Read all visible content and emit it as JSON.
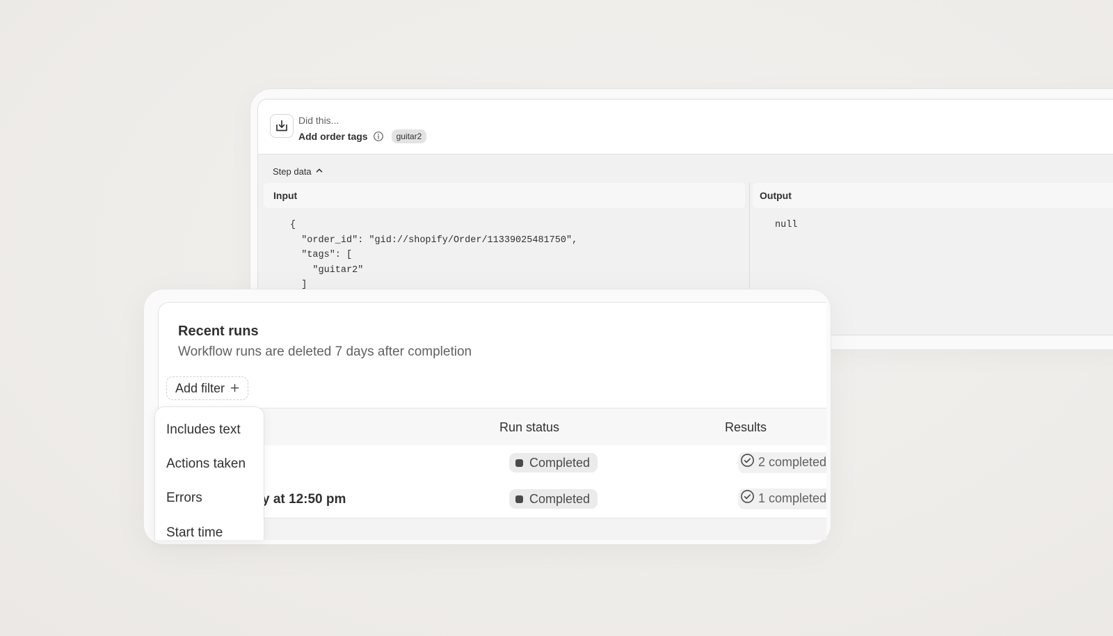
{
  "step": {
    "heading": "Did this...",
    "action_name": "Add order tags",
    "tag": "guitar2",
    "step_data_label": "Step data",
    "input_label": "Input",
    "output_label": "Output",
    "input_code": "{\n  \"order_id\": \"gid://shopify/Order/11339025481750\",\n  \"tags\": [\n    \"guitar2\"\n  ]",
    "output_code": "null"
  },
  "runs": {
    "title": "Recent runs",
    "subtitle": "Workflow runs are deleted 7 days after completion",
    "add_filter_label": "Add filter",
    "columns": {
      "run_status": "Run status",
      "results": "Results"
    },
    "rows": [
      {
        "date": "",
        "status": "Completed",
        "result": "2 completed"
      },
      {
        "date": "y at 12:50 pm",
        "status": "Completed",
        "result": "1 completed"
      }
    ]
  },
  "filter_menu": {
    "items": [
      "Includes text",
      "Actions taken",
      "Errors",
      "Start time"
    ]
  }
}
